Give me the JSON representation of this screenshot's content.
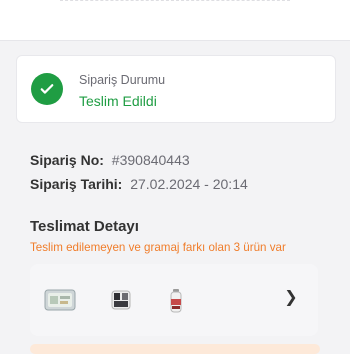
{
  "status": {
    "label": "Sipariş Durumu",
    "value": "Teslim Edildi",
    "icon": "check-circle-icon",
    "color": "#1f9d43"
  },
  "order": {
    "no_label": "Sipariş No:",
    "no_value": "#390840443",
    "date_label": "Sipariş Tarihi:",
    "date_value": "27.02.2024 - 20:14"
  },
  "delivery": {
    "title": "Teslimat Detayı",
    "subtitle": "Teslim edilemeyen ve gramaj farkı olan 3 ürün var",
    "subtitle_color": "#f07d2b",
    "products": [
      {
        "icon": "product-image-1"
      },
      {
        "icon": "product-image-2"
      },
      {
        "icon": "product-image-3"
      }
    ],
    "more_icon": "chevron-right-icon"
  }
}
